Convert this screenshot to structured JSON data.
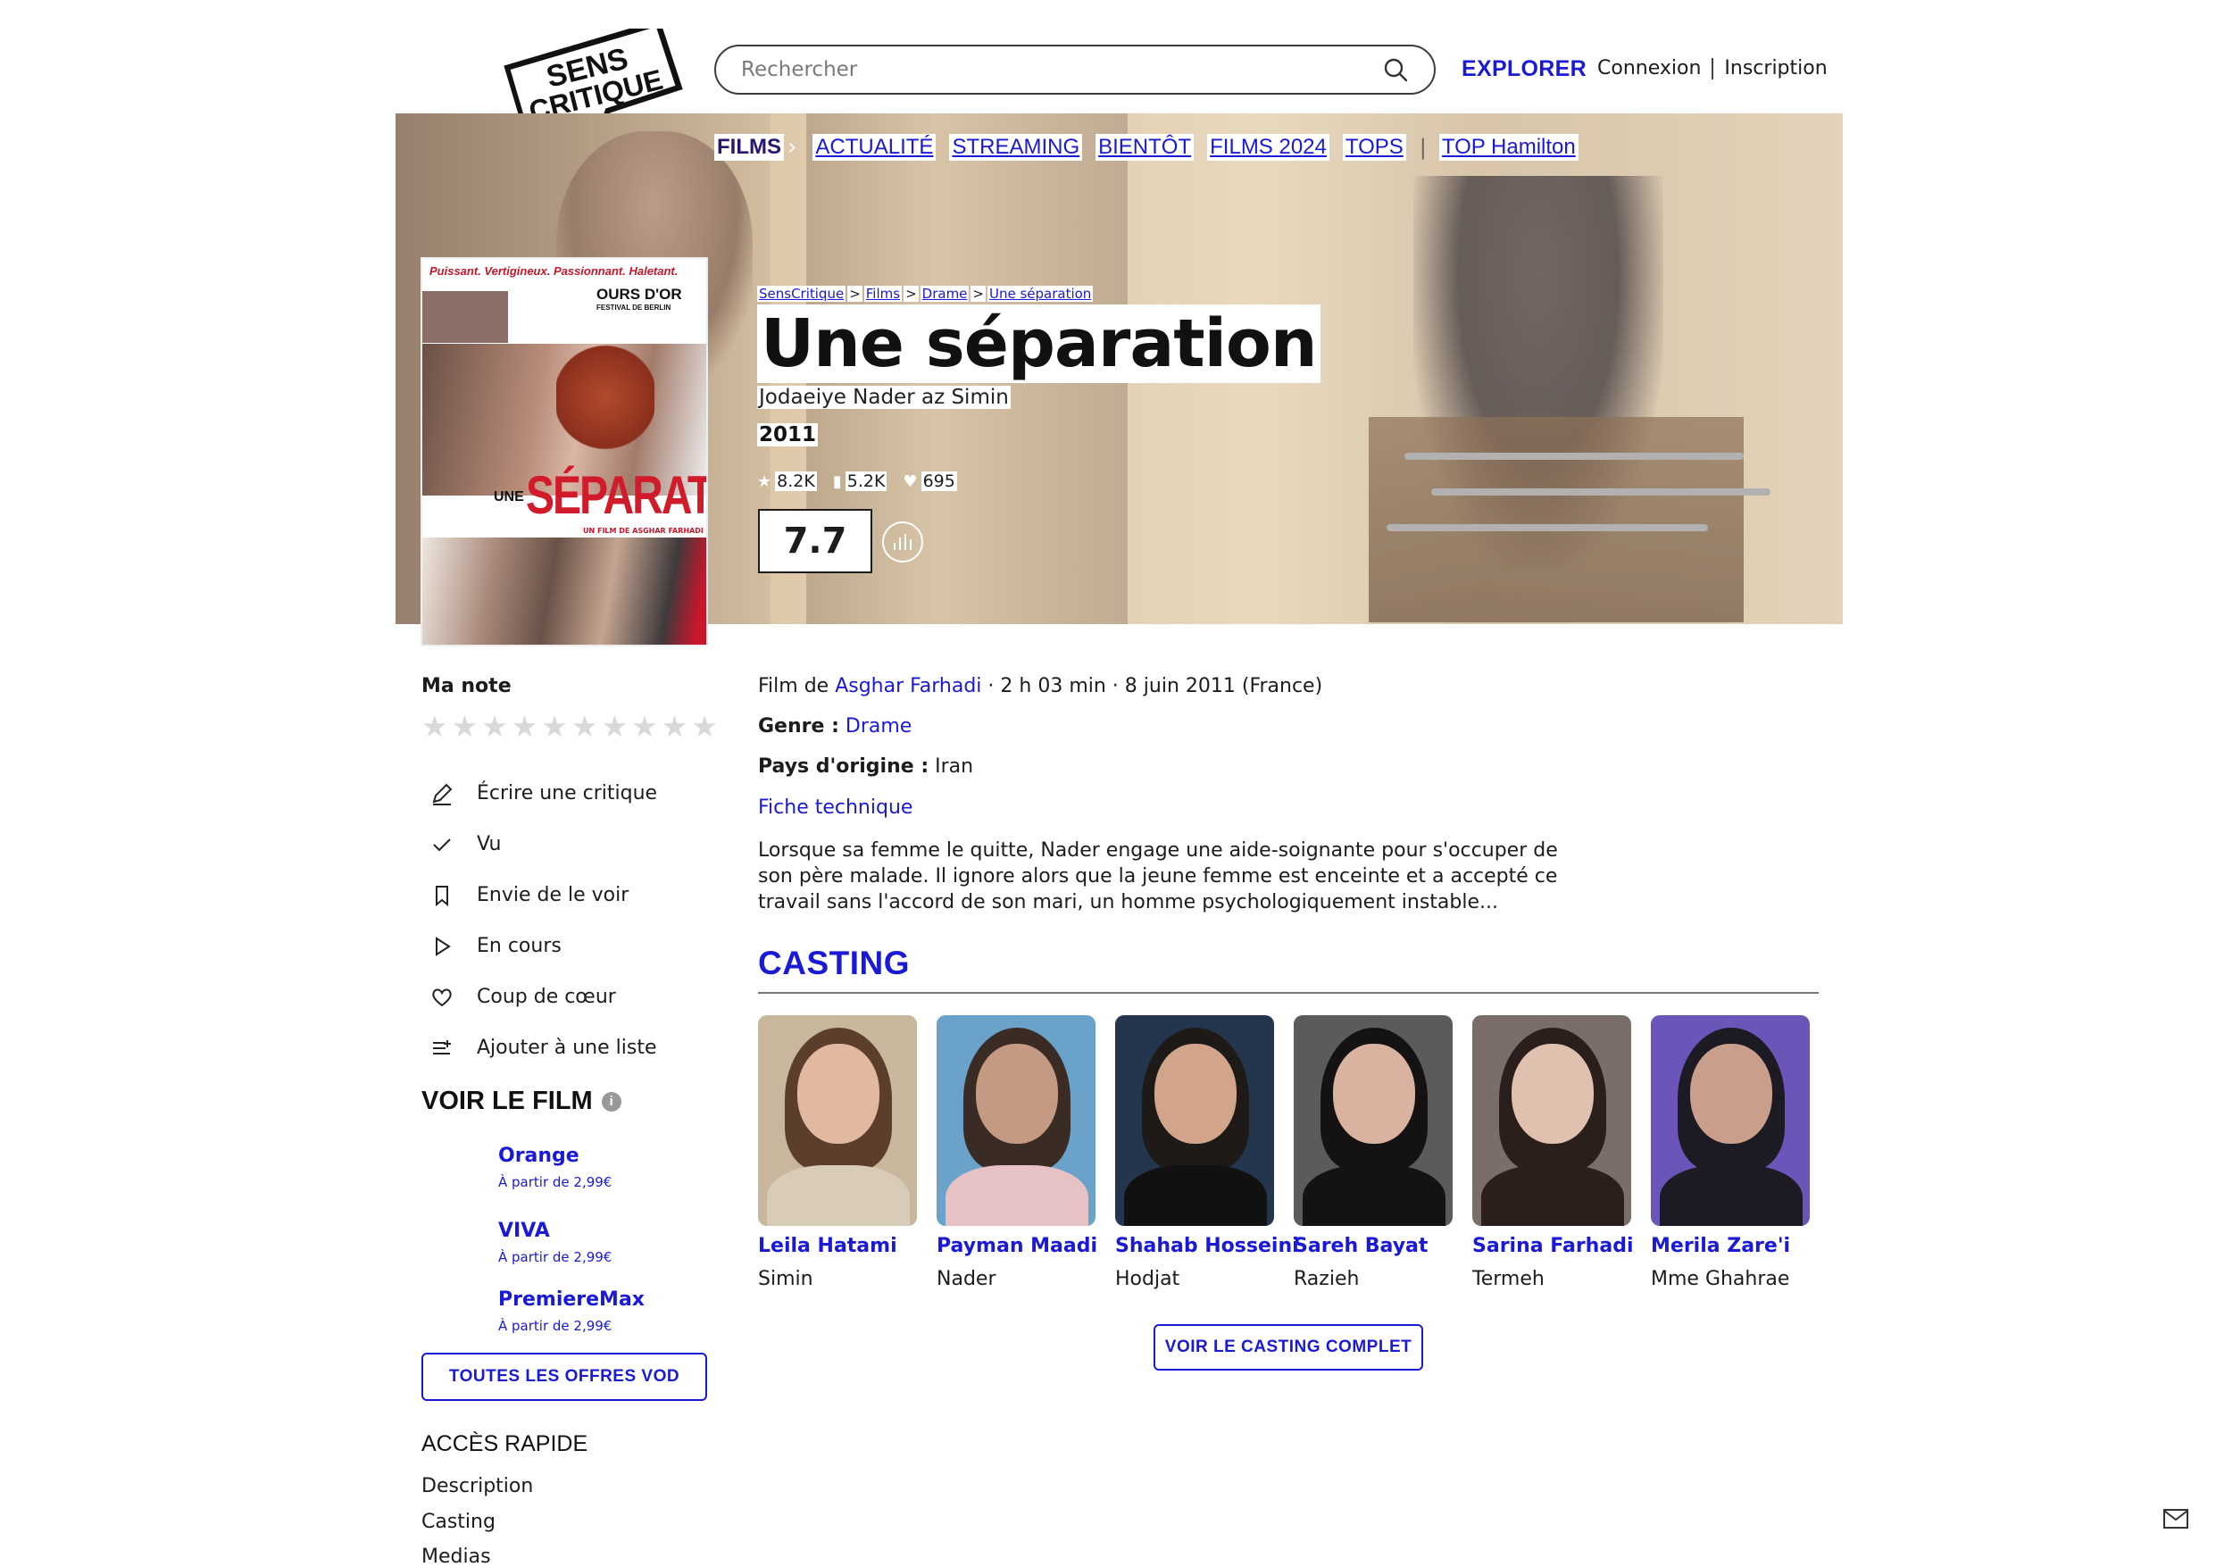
{
  "header": {
    "logo_text": "SENS CRITIQUE",
    "search_placeholder": "Rechercher",
    "explorer": "EXPLORER",
    "login": "Connexion",
    "signup": "Inscription"
  },
  "nav": {
    "active": "FILMS",
    "items": [
      "ACTUALITÉ",
      "STREAMING",
      "BIENTÔT",
      "FILMS 2024",
      "TOPS"
    ],
    "extra": "TOP Hamilton"
  },
  "poster": {
    "tagline": "Puissant. Vertigineux. Passionnant. Haletant.",
    "award_line1": "OURS D'OR",
    "award_line2": "FESTIVAL DE BERLIN",
    "title_small": "UNE",
    "title_big": "SÉPARATION",
    "director": "UN FILM DE ASGHAR FARHADI"
  },
  "breadcrumb": [
    "SensCritique",
    "Films",
    "Drame",
    "Une séparation"
  ],
  "film": {
    "title": "Une séparation",
    "original_title": "Jodaeiye Nader az Simin",
    "year": "2011",
    "stat_ratings": "8.2K",
    "stat_wishlist": "5.2K",
    "stat_favorites": "695",
    "score": "7.7"
  },
  "sidebar": {
    "my_rating_label": "Ma note",
    "stars_count": 10,
    "actions": [
      {
        "label": "Écrire une critique",
        "icon": "pencil-icon"
      },
      {
        "label": "Vu",
        "icon": "check-icon"
      },
      {
        "label": "Envie de le voir",
        "icon": "bookmark-icon"
      },
      {
        "label": "En cours",
        "icon": "play-icon"
      },
      {
        "label": "Coup de cœur",
        "icon": "heart-icon"
      },
      {
        "label": "Ajouter à une liste",
        "icon": "list-add-icon"
      }
    ],
    "vod_title": "VOIR LE FILM",
    "vod": [
      {
        "name": "Orange",
        "price": "À partir de 2,99€"
      },
      {
        "name": "VIVA",
        "price": "À partir de 2,99€"
      },
      {
        "name": "PremiereMax",
        "price": "À partir de 2,99€"
      }
    ],
    "vod_button": "TOUTES LES OFFRES VOD",
    "quick_title": "ACCÈS RAPIDE",
    "quick_links": [
      "Description",
      "Casting",
      "Medias"
    ]
  },
  "details": {
    "film_by_prefix": "Film de",
    "director": "Asghar Farhadi",
    "meta": " · 2 h 03 min · 8 juin 2011 (France)",
    "genre_label": "Genre :",
    "genre": "Drame",
    "country_label": "Pays d'origine :",
    "country": "Iran",
    "tech_sheet": "Fiche technique",
    "synopsis": "Lorsque sa femme le quitte, Nader engage une aide-soignante pour s'occuper de son père malade. Il ignore alors que la jeune femme est enceinte et a accepté ce travail sans l'accord de son mari, un homme psychologiquement instable..."
  },
  "casting": {
    "title": "CASTING",
    "members": [
      {
        "name": "Leila Hatami",
        "role": "Simin"
      },
      {
        "name": "Payman Maadi",
        "role": "Nader"
      },
      {
        "name": "Shahab Hosseini",
        "role": "Hodjat"
      },
      {
        "name": "Sareh Bayat",
        "role": "Razieh"
      },
      {
        "name": "Sarina Farhadi",
        "role": "Termeh"
      },
      {
        "name": "Merila Zare'i",
        "role": "Mme Ghahrae"
      }
    ],
    "full_button": "VOIR LE CASTING COMPLET"
  }
}
